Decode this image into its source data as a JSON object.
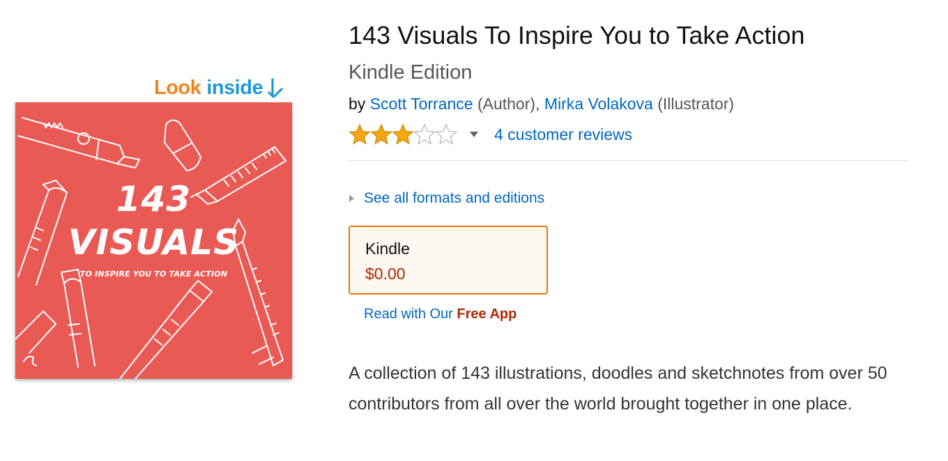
{
  "look_inside": {
    "word1": "Look",
    "word2": "inside"
  },
  "cover": {
    "title_line1": "143",
    "title_line2": "VISUALS",
    "subtitle": "TO INSPIRE YOU TO TAKE ACTION"
  },
  "product": {
    "title": "143 Visuals To Inspire You to Take Action",
    "edition": "Kindle Edition",
    "by_prefix": "by",
    "author_name": "Scott Torrance",
    "author_role": "(Author),",
    "illustrator_name": "Mirka Volakova",
    "illustrator_role": "(Illustrator)"
  },
  "rating": {
    "stars": 3,
    "max_stars": 5,
    "reviews_link": "4 customer reviews"
  },
  "formats": {
    "link": "See all formats and editions"
  },
  "format_box": {
    "name": "Kindle",
    "price": "$0.00"
  },
  "free_app": {
    "prefix": "Read with Our",
    "strong": "Free App"
  },
  "description": "A collection of 143 illustrations, doodles and sketchnotes from over 50 contributors from all over the world brought together in one place.",
  "colors": {
    "link": "#0066c0",
    "price": "#b12704",
    "star": "#f6a610",
    "box_border": "#e77600",
    "cover_bg": "#e95a55",
    "look": "#f0851f",
    "inside": "#1f9ad6"
  }
}
